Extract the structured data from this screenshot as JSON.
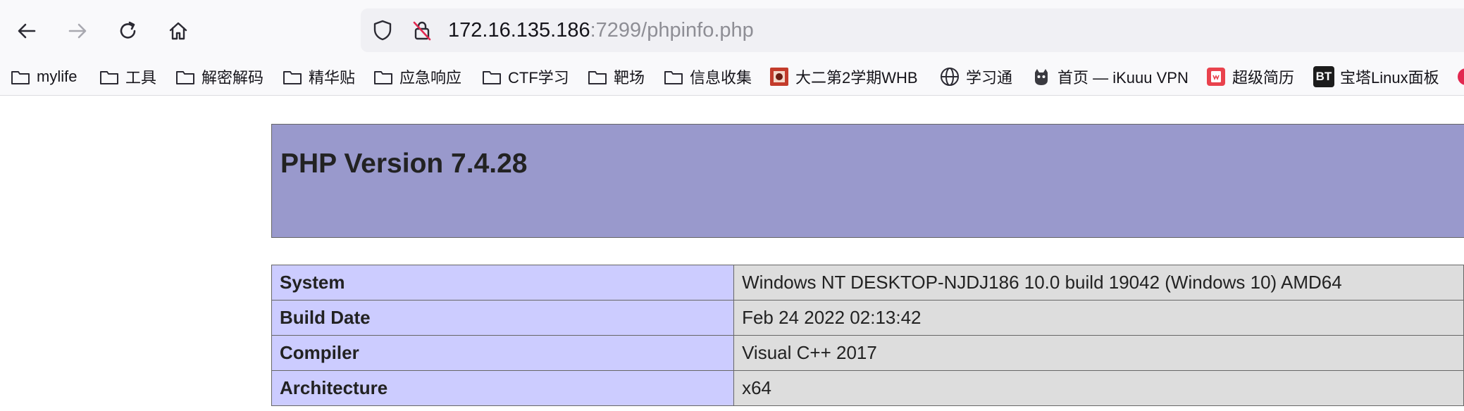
{
  "browser": {
    "url_host": "172.16.135.186",
    "url_rest": ":7299/phpinfo.php",
    "bookmarks": [
      {
        "label": "mylife",
        "icon": "folder-icon"
      },
      {
        "label": "工具",
        "icon": "folder-icon"
      },
      {
        "label": "解密解码",
        "icon": "folder-icon"
      },
      {
        "label": "精华贴",
        "icon": "folder-icon"
      },
      {
        "label": "应急响应",
        "icon": "folder-icon"
      },
      {
        "label": "CTF学习",
        "icon": "folder-icon"
      },
      {
        "label": "靶场",
        "icon": "folder-icon"
      },
      {
        "label": "信息收集",
        "icon": "folder-icon"
      },
      {
        "label": "大二第2学期WHB",
        "icon": "site-favicon"
      },
      {
        "label": "学习通",
        "icon": "globe-icon"
      },
      {
        "label": "首页 — iKuuu VPN",
        "icon": "cat-favicon"
      },
      {
        "label": "超级简历",
        "icon": "resume-favicon"
      },
      {
        "label": "宝塔Linux面板",
        "icon": "bt-favicon"
      }
    ],
    "bt_badge": "BT"
  },
  "page": {
    "title": "PHP Version 7.4.28",
    "rows": [
      {
        "key": "System",
        "value": "Windows NT DESKTOP-NJDJ186 10.0 build 19042 (Windows 10) AMD64"
      },
      {
        "key": "Build Date",
        "value": "Feb 24 2022 02:13:42"
      },
      {
        "key": "Compiler",
        "value": "Visual C++ 2017"
      },
      {
        "key": "Architecture",
        "value": "x64"
      }
    ]
  },
  "colors": {
    "header_bg": "#9999cc",
    "key_bg": "#ccccff",
    "value_bg": "#dddddd"
  }
}
